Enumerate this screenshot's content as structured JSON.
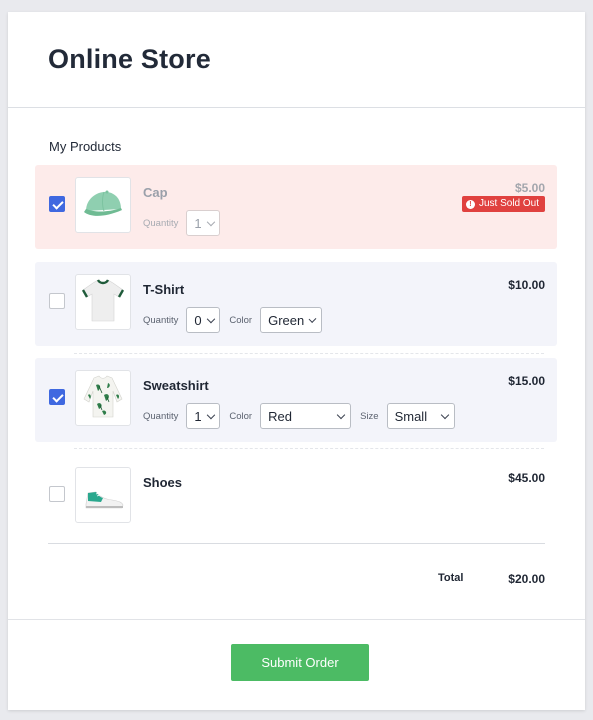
{
  "header": {
    "title": "Online Store"
  },
  "section": {
    "title": "My Products"
  },
  "labels": {
    "quantity": "Quantity",
    "color": "Color",
    "size": "Size"
  },
  "products": [
    {
      "name": "Cap",
      "price": "$5.00",
      "checked": true,
      "status": "Just Sold Out",
      "quantity": "1",
      "image": "cap"
    },
    {
      "name": "T-Shirt",
      "price": "$10.00",
      "checked": false,
      "quantity": "0",
      "color": "Green",
      "image": "tshirt"
    },
    {
      "name": "Sweatshirt",
      "price": "$15.00",
      "checked": true,
      "quantity": "1",
      "color": "Red",
      "size": "Small",
      "image": "sweatshirt"
    },
    {
      "name": "Shoes",
      "price": "$45.00",
      "checked": false,
      "image": "shoes"
    }
  ],
  "total": {
    "label": "Total",
    "value": "$20.00"
  },
  "footer": {
    "submit_label": "Submit Order"
  },
  "colors": {
    "accent": "#3f68e0",
    "submit": "#4cbb64",
    "sold_out_badge": "#e0413f",
    "sold_out_row": "#fdebea"
  }
}
